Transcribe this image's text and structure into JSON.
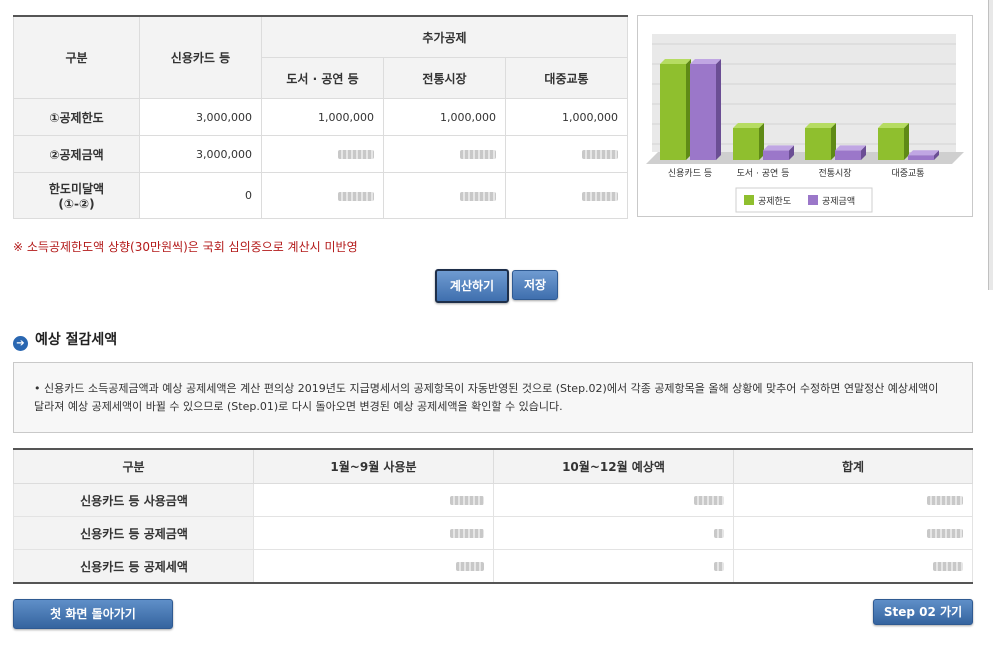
{
  "deduction_table": {
    "header_category": "구분",
    "header_card": "신용카드 등",
    "header_extra": "추가공제",
    "sub_books": "도서 · 공연 등",
    "sub_market": "전통시장",
    "sub_transit": "대중교통",
    "rows": [
      {
        "label": "①공제한도",
        "card": "3,000,000",
        "books": "1,000,000",
        "market": "1,000,000",
        "transit": "1,000,000"
      },
      {
        "label": "②공제금액",
        "card": "3,000,000"
      },
      {
        "label_line1": "한도미달액",
        "label_line2": "(①-②)",
        "card": "0"
      }
    ]
  },
  "chart_data": {
    "type": "bar",
    "categories": [
      "신용카드 등",
      "도서 · 공연 등",
      "전통시장",
      "대중교통"
    ],
    "series": [
      {
        "name": "공제한도",
        "values": [
          3000000,
          1000000,
          1000000,
          1000000
        ]
      },
      {
        "name": "공제금액",
        "values": [
          3000000,
          300000,
          300000,
          150000
        ]
      }
    ],
    "legend": "bottom",
    "colors": {
      "limit": "#8fbf2e",
      "amount": "#9b77c9"
    }
  },
  "notice": "※ 소득공제한도액 상향(30만원씩)은 국회 심의중으로 계산시 미반영",
  "buttons": {
    "calculate": "계산하기",
    "save": "저장",
    "home": "첫 화면 돌아가기",
    "step2": "Step 02 가기"
  },
  "section": {
    "title": "예상 절감세액"
  },
  "info_text": "• 신용카드 소득공제금액과 예상 공제세액은 계산 편의상 2019년도 지급명세서의 공제항목이 자동반영된 것으로 (Step.02)에서 각종 공제항목을 올해 상황에 맞추어 수정하면 연말정산 예상세액이 달라져 예상 공제세액이 바뀔 수 있으므로 (Step.01)로 다시 돌아오면 변경된 예상 공제세액을 확인할 수 있습니다.",
  "savings_table": {
    "headers": [
      "구분",
      "1월~9월 사용분",
      "10월~12월 예상액",
      "합계"
    ],
    "rows": [
      "신용카드 등 사용금액",
      "신용카드 등 공제금액",
      "신용카드 등 공제세액"
    ]
  }
}
